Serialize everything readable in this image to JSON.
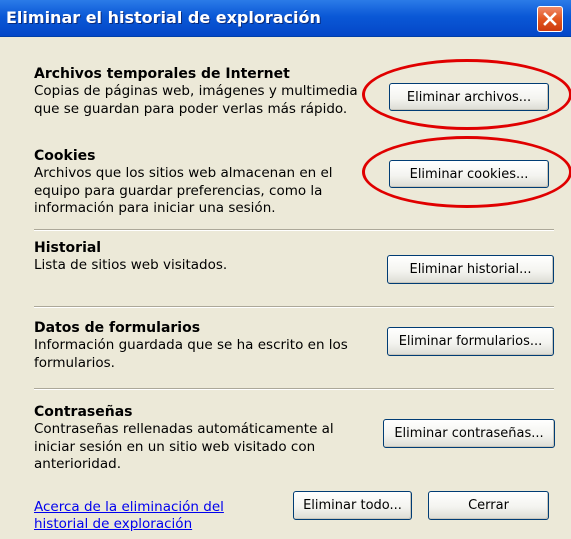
{
  "window": {
    "title": "Eliminar el historial de exploración",
    "close_icon": "close-icon"
  },
  "sections": {
    "temp_files": {
      "heading": "Archivos temporales de Internet",
      "desc": [
        "Copias de páginas web, imágenes y multimedia",
        "que se guardan para poder verlas más rápido."
      ],
      "button": "Eliminar archivos..."
    },
    "cookies": {
      "heading": "Cookies",
      "desc": [
        "Archivos que los sitios web almacenan en el",
        "equipo para guardar preferencias, como la",
        "información para iniciar una sesión."
      ],
      "button": "Eliminar cookies..."
    },
    "history": {
      "heading": "Historial",
      "desc": [
        "Lista de sitios web visitados."
      ],
      "button": "Eliminar historial..."
    },
    "forms": {
      "heading": "Datos de formularios",
      "desc": [
        "Información guardada que se ha escrito en los",
        "formularios."
      ],
      "button": "Eliminar formularios..."
    },
    "passwords": {
      "heading": "Contraseñas",
      "desc": [
        "Contraseñas rellenadas automáticamente al",
        "iniciar sesión en un sitio web visitado con",
        "anterioridad."
      ],
      "button": "Eliminar contraseñas..."
    }
  },
  "footer": {
    "link": [
      "Acerca de la eliminación del",
      "historial de exploración"
    ],
    "delete_all": "Eliminar todo...",
    "close": "Cerrar"
  },
  "annotation_color": "#e00000"
}
